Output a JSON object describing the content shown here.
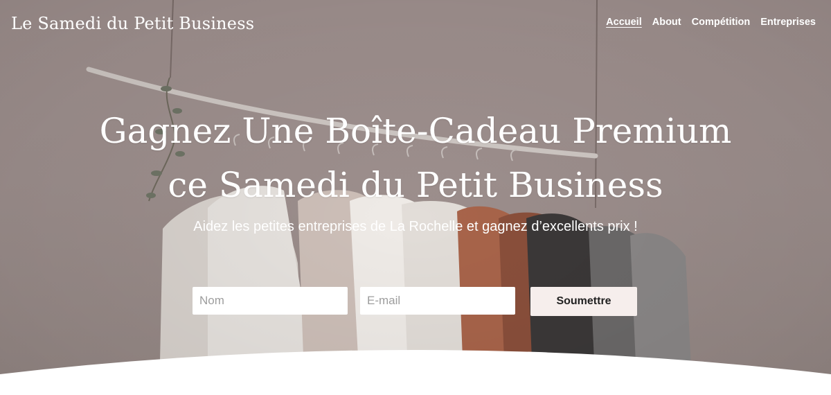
{
  "header": {
    "brand": "Le Samedi du Petit Business",
    "nav": [
      {
        "label": "Accueil",
        "active": true
      },
      {
        "label": "About",
        "active": false
      },
      {
        "label": "Compétition",
        "active": false
      },
      {
        "label": "Entreprises",
        "active": false
      }
    ]
  },
  "hero": {
    "headline_line1": "Gagnez Une Boîte-Cadeau Premium",
    "headline_line2": "ce Samedi du Petit Business",
    "subtitle": "Aidez les petites entreprises de La Rochelle et gagnez d’excellents prix !"
  },
  "form": {
    "name_placeholder": "Nom",
    "email_placeholder": "E-mail",
    "submit_label": "Soumettre"
  },
  "colors": {
    "overlay": "#9d8f8d",
    "submit_bg": "#f6eeec",
    "text": "#ffffff"
  }
}
